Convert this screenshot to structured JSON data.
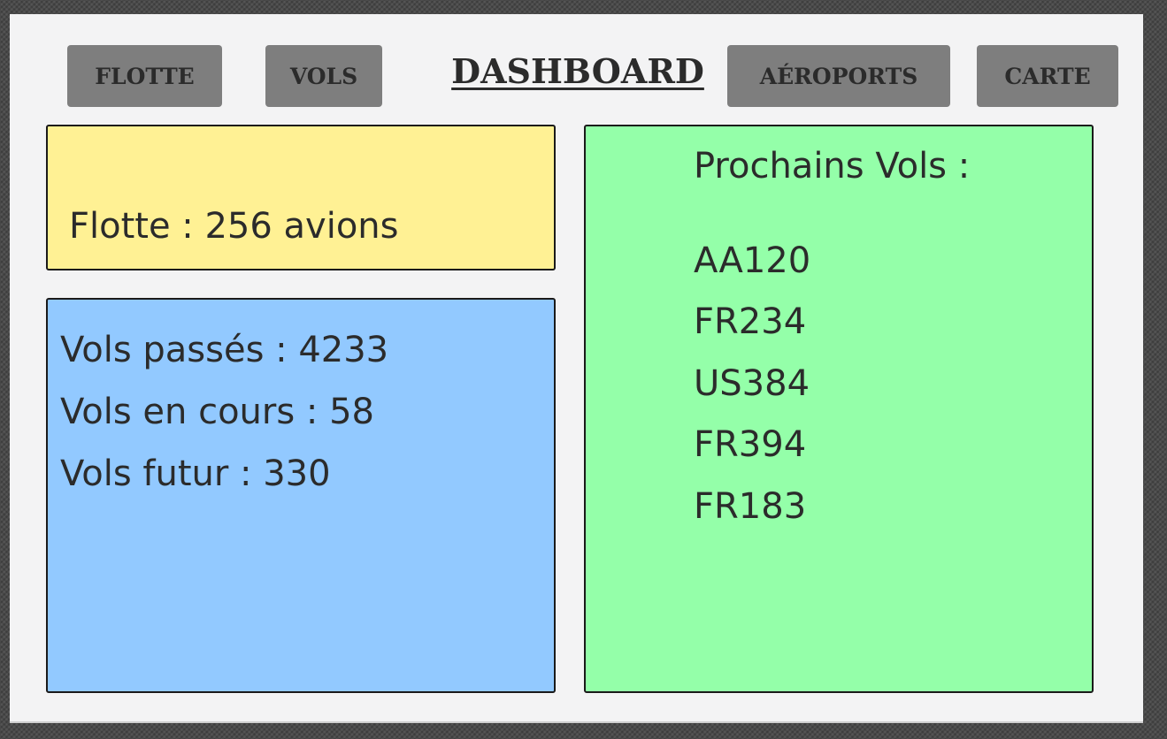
{
  "header": {
    "title": "DASHBOARD",
    "nav": {
      "flotte": "FLOTTE",
      "vols": "VOLS",
      "aeroports": "AÉROPORTS",
      "carte": "CARTE"
    }
  },
  "fleet": {
    "text": "Flotte : 256 avions"
  },
  "flights": {
    "past": "Vols passés : 4233",
    "ongoing": "Vols en cours : 58",
    "future": "Vols futur : 330"
  },
  "next_flights": {
    "title": "Prochains Vols :",
    "codes": [
      "AA120",
      "FR234",
      "US384",
      "FR394",
      "FR183"
    ]
  },
  "colors": {
    "fleet_card": "#fff194",
    "flights_card": "#92c9ff",
    "next_flights_card": "#94ffa9",
    "nav_button": "#7e7e7e",
    "text": "#2b2b2b"
  }
}
